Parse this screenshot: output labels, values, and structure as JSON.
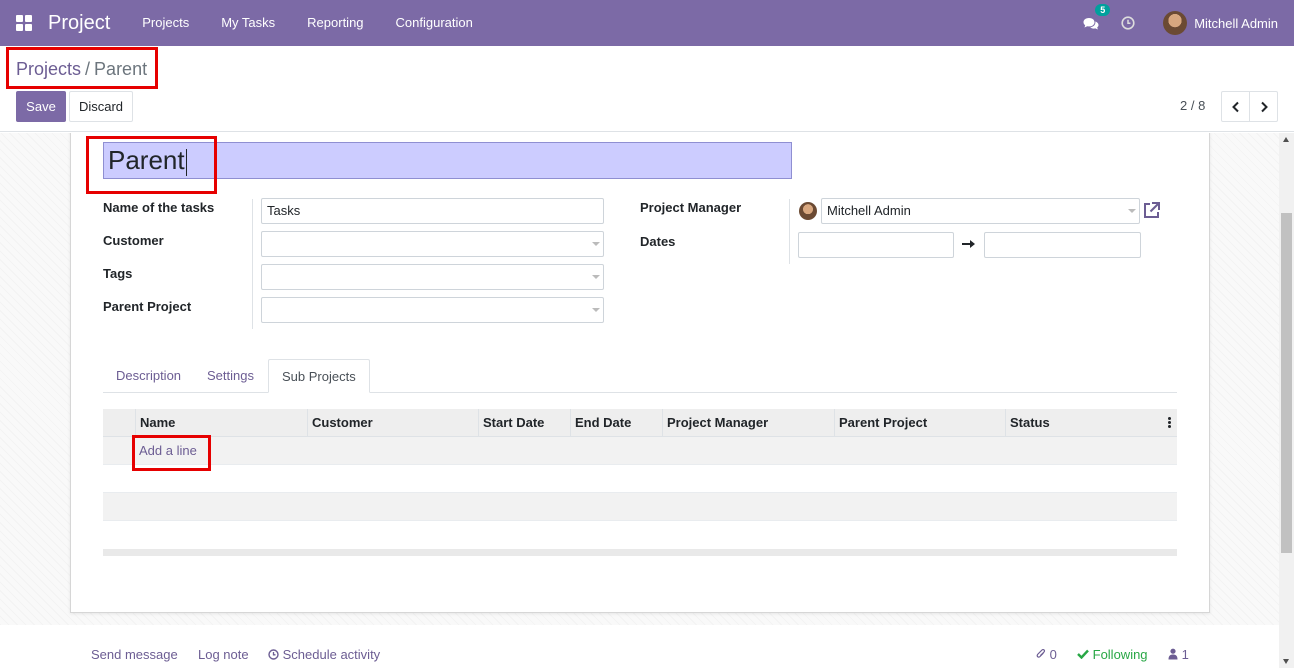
{
  "navbar": {
    "app_name": "Project",
    "menu": [
      "Projects",
      "My Tasks",
      "Reporting",
      "Configuration"
    ],
    "chat_count": "5",
    "user_name": "Mitchell Admin",
    "bg_color": "#7c6aa6"
  },
  "breadcrumb": {
    "parent": "Projects",
    "separator": "/",
    "current": "Parent"
  },
  "actions": {
    "save_label": "Save",
    "discard_label": "Discard"
  },
  "pager": {
    "value": "2 / 8"
  },
  "form": {
    "title": "Parent",
    "left_fields": [
      {
        "label": "Name of the tasks",
        "value": "Tasks"
      },
      {
        "label": "Customer",
        "value": ""
      },
      {
        "label": "Tags",
        "value": ""
      },
      {
        "label": "Parent Project",
        "value": ""
      }
    ],
    "right_fields": {
      "manager_label": "Project Manager",
      "manager_value": "Mitchell Admin",
      "dates_label": "Dates",
      "date_start": "",
      "date_end": ""
    }
  },
  "tabs": [
    "Description",
    "Settings",
    "Sub Projects"
  ],
  "active_tab": "Sub Projects",
  "table": {
    "columns": [
      "Name",
      "Customer",
      "Start Date",
      "End Date",
      "Project Manager",
      "Parent Project",
      "Status"
    ],
    "add_line_label": "Add a line"
  },
  "chatter": {
    "send_message": "Send message",
    "log_note": "Log note",
    "schedule_activity": "Schedule activity",
    "attachments": "0",
    "following": "Following",
    "followers": "1"
  },
  "highlight_color": "#e60000"
}
